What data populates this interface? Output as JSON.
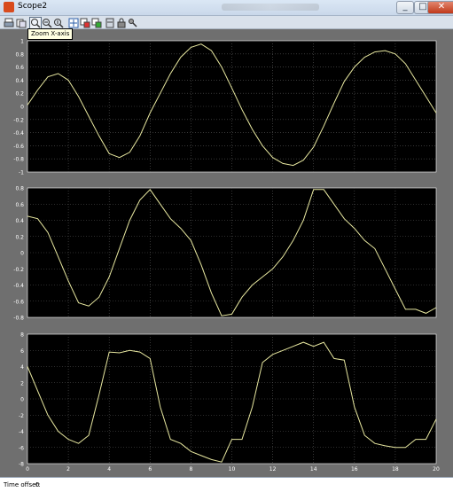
{
  "window": {
    "title": "Scope2",
    "minimize": "_",
    "maximize": "□",
    "close": "✕"
  },
  "toolbar": {
    "tooltip": "Zoom X-axis",
    "buttons": [
      "print-icon",
      "parameters-icon",
      "zoom-icon",
      "zoom-x-icon",
      "zoom-y-icon",
      "autoscale-icon",
      "save-axes-icon",
      "restore-axes-icon",
      "floating-scope-icon",
      "lock-axes-icon",
      "signal-selection-icon"
    ]
  },
  "status": {
    "time_offset_label": "Time offset:",
    "time_offset_value": "0"
  },
  "colors": {
    "trace": "#e8e8a0",
    "axes_bg": "#000000",
    "grid": "#595959",
    "tick_text": "#ffffff"
  },
  "chart_data": [
    {
      "type": "line",
      "xlim": [
        0,
        20
      ],
      "ylim": [
        -1,
        1
      ],
      "xticks": [],
      "yticks": [
        "1",
        "0.8",
        "0.6",
        "0.4",
        "0.2",
        "0",
        "-0.2",
        "-0.4",
        "-0.6",
        "-0.8",
        "-1"
      ],
      "grid": true,
      "x": [
        0,
        0.5,
        1,
        1.5,
        2,
        2.5,
        3,
        3.5,
        4,
        4.5,
        5,
        5.5,
        6,
        6.5,
        7,
        7.5,
        8,
        8.5,
        9,
        9.5,
        10,
        10.5,
        11,
        11.5,
        12,
        12.5,
        13,
        13.5,
        14,
        14.5,
        15,
        15.5,
        16,
        16.5,
        17,
        17.5,
        18,
        18.5,
        19,
        19.5,
        20
      ],
      "y": [
        0.02,
        0.25,
        0.45,
        0.5,
        0.4,
        0.15,
        -0.15,
        -0.45,
        -0.72,
        -0.78,
        -0.7,
        -0.45,
        -0.1,
        0.2,
        0.5,
        0.75,
        0.9,
        0.95,
        0.85,
        0.6,
        0.28,
        -0.05,
        -0.35,
        -0.6,
        -0.78,
        -0.87,
        -0.9,
        -0.82,
        -0.62,
        -0.3,
        0.05,
        0.38,
        0.6,
        0.75,
        0.83,
        0.85,
        0.8,
        0.65,
        0.4,
        0.15,
        -0.1
      ]
    },
    {
      "type": "line",
      "xlim": [
        0,
        20
      ],
      "ylim": [
        -0.8,
        0.8
      ],
      "xticks": [],
      "yticks": [
        "0.8",
        "0.6",
        "0.4",
        "0.2",
        "0",
        "-0.2",
        "-0.4",
        "-0.6",
        "-0.8"
      ],
      "grid": true,
      "x": [
        0,
        0.5,
        1,
        1.5,
        2,
        2.5,
        3,
        3.5,
        4,
        4.5,
        5,
        5.5,
        6,
        6.5,
        7,
        7.5,
        8,
        8.5,
        9,
        9.5,
        10,
        10.5,
        11,
        11.5,
        12,
        12.5,
        13,
        13.5,
        14,
        14.5,
        15,
        15.5,
        16,
        16.5,
        17,
        17.5,
        18,
        18.5,
        19,
        19.5,
        20
      ],
      "y": [
        0.45,
        0.42,
        0.25,
        -0.05,
        -0.35,
        -0.62,
        -0.66,
        -0.55,
        -0.3,
        0.05,
        0.4,
        0.65,
        0.78,
        0.6,
        0.42,
        0.3,
        0.15,
        -0.15,
        -0.5,
        -0.78,
        -0.76,
        -0.55,
        -0.4,
        -0.3,
        -0.2,
        -0.05,
        0.15,
        0.4,
        0.78,
        0.78,
        0.6,
        0.42,
        0.3,
        0.15,
        0.05,
        -0.2,
        -0.45,
        -0.7,
        -0.7,
        -0.75,
        -0.68
      ]
    },
    {
      "type": "line",
      "xlim": [
        0,
        20
      ],
      "ylim": [
        -8,
        8
      ],
      "xticks": [
        "0",
        "2",
        "4",
        "6",
        "8",
        "10",
        "12",
        "14",
        "16",
        "18",
        "20"
      ],
      "yticks": [
        "8",
        "6",
        "4",
        "2",
        "0",
        "-2",
        "-4",
        "-6",
        "-8"
      ],
      "grid": true,
      "x": [
        0,
        0.5,
        1,
        1.5,
        2,
        2.5,
        3,
        3.5,
        4,
        4.5,
        5,
        5.5,
        6,
        6.5,
        7,
        7.5,
        8,
        8.5,
        9,
        9.5,
        10,
        10.5,
        11,
        11.5,
        12,
        12.5,
        13,
        13.5,
        14,
        14.5,
        15,
        15.5,
        16,
        16.5,
        17,
        17.5,
        18,
        18.5,
        19,
        19.5,
        20
      ],
      "y": [
        4.0,
        1.0,
        -2.0,
        -4.0,
        -5.0,
        -5.5,
        -4.5,
        0.5,
        5.8,
        5.7,
        6.0,
        5.8,
        5.0,
        -1.0,
        -5.0,
        -5.5,
        -6.5,
        -7.0,
        -7.5,
        -7.8,
        -5.0,
        -5.0,
        -1.0,
        4.5,
        5.5,
        6.0,
        6.5,
        7.0,
        6.5,
        7.0,
        5.0,
        4.8,
        -1.0,
        -4.5,
        -5.5,
        -5.8,
        -6.0,
        -6.0,
        -5.0,
        -5.0,
        -2.5
      ]
    }
  ]
}
